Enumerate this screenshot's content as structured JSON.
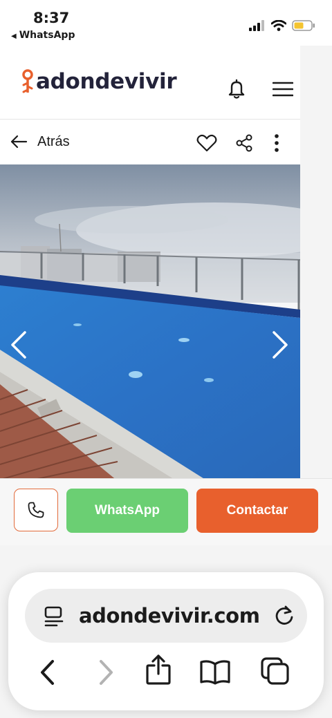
{
  "status": {
    "time": "8:37",
    "back_app": "WhatsApp"
  },
  "header": {
    "logo_text": "adondevivir",
    "brand_color": "#e8602d"
  },
  "toolbar": {
    "back_label": "Atrás"
  },
  "cta": {
    "whatsapp_label": "WhatsApp",
    "contact_label": "Contactar"
  },
  "browser": {
    "url": "adondevivir.com"
  }
}
